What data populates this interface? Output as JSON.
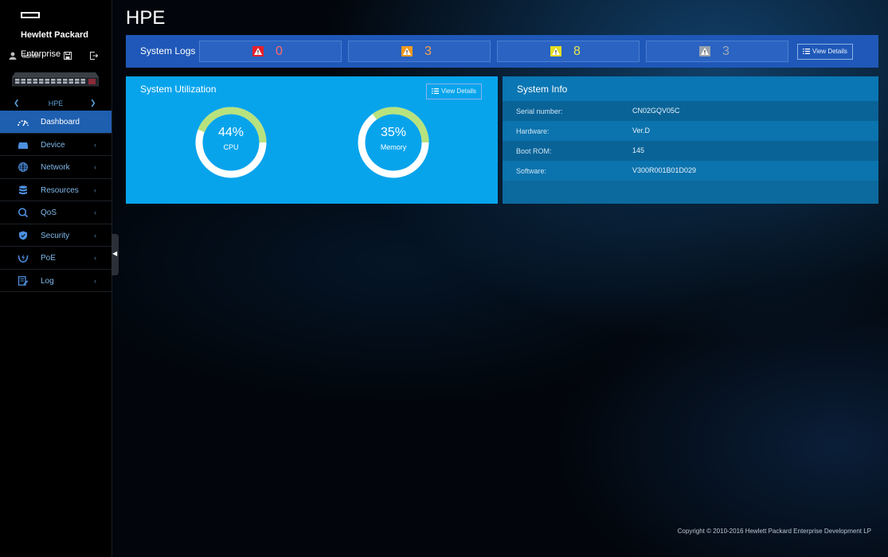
{
  "brand": {
    "line1": "Hewlett Packard",
    "line2": "Enterprise"
  },
  "user": {
    "name": "admin"
  },
  "device_nav": {
    "name": "HPE"
  },
  "sidebar": {
    "items": [
      {
        "label": "Dashboard",
        "icon": "speedometer-icon",
        "active": true
      },
      {
        "label": "Device",
        "icon": "device-icon"
      },
      {
        "label": "Network",
        "icon": "globe-icon"
      },
      {
        "label": "Resources",
        "icon": "database-icon"
      },
      {
        "label": "QoS",
        "icon": "qos-icon"
      },
      {
        "label": "Security",
        "icon": "shield-icon"
      },
      {
        "label": "PoE",
        "icon": "poe-icon"
      },
      {
        "label": "Log",
        "icon": "log-icon"
      }
    ],
    "arrow": "‹"
  },
  "page": {
    "title": "HPE"
  },
  "system_logs": {
    "title": "System Logs",
    "levels": [
      {
        "count": "0",
        "color": "#e8202a",
        "text_color": "#ff6b6b"
      },
      {
        "count": "3",
        "color": "#f39a1d",
        "text_color": "#f5a24a"
      },
      {
        "count": "8",
        "color": "#e4de22",
        "text_color": "#ece64a"
      },
      {
        "count": "3",
        "color": "#9aa3ad",
        "text_color": "#9fa9b6"
      }
    ],
    "view_details": "View Details"
  },
  "utilization": {
    "title": "System Utilization",
    "view_details": "View Details",
    "cpu": {
      "value": "44%",
      "label": "CPU",
      "fraction": 0.44
    },
    "memory": {
      "value": "35%",
      "label": "Memory",
      "fraction": 0.35
    },
    "ring_color": "#ffffff",
    "fill_color": "#b8e27e"
  },
  "system_info": {
    "title": "System Info",
    "rows": [
      {
        "key": "Serial number:",
        "value": "CN02GQV05C"
      },
      {
        "key": "Hardware:",
        "value": "Ver.D"
      },
      {
        "key": "Boot ROM:",
        "value": "145"
      },
      {
        "key": "Software:",
        "value": "V300R001B01D029"
      }
    ]
  },
  "footer": {
    "copyright": "Copyright © 2010-2016 Hewlett Packard Enterprise Development LP"
  }
}
